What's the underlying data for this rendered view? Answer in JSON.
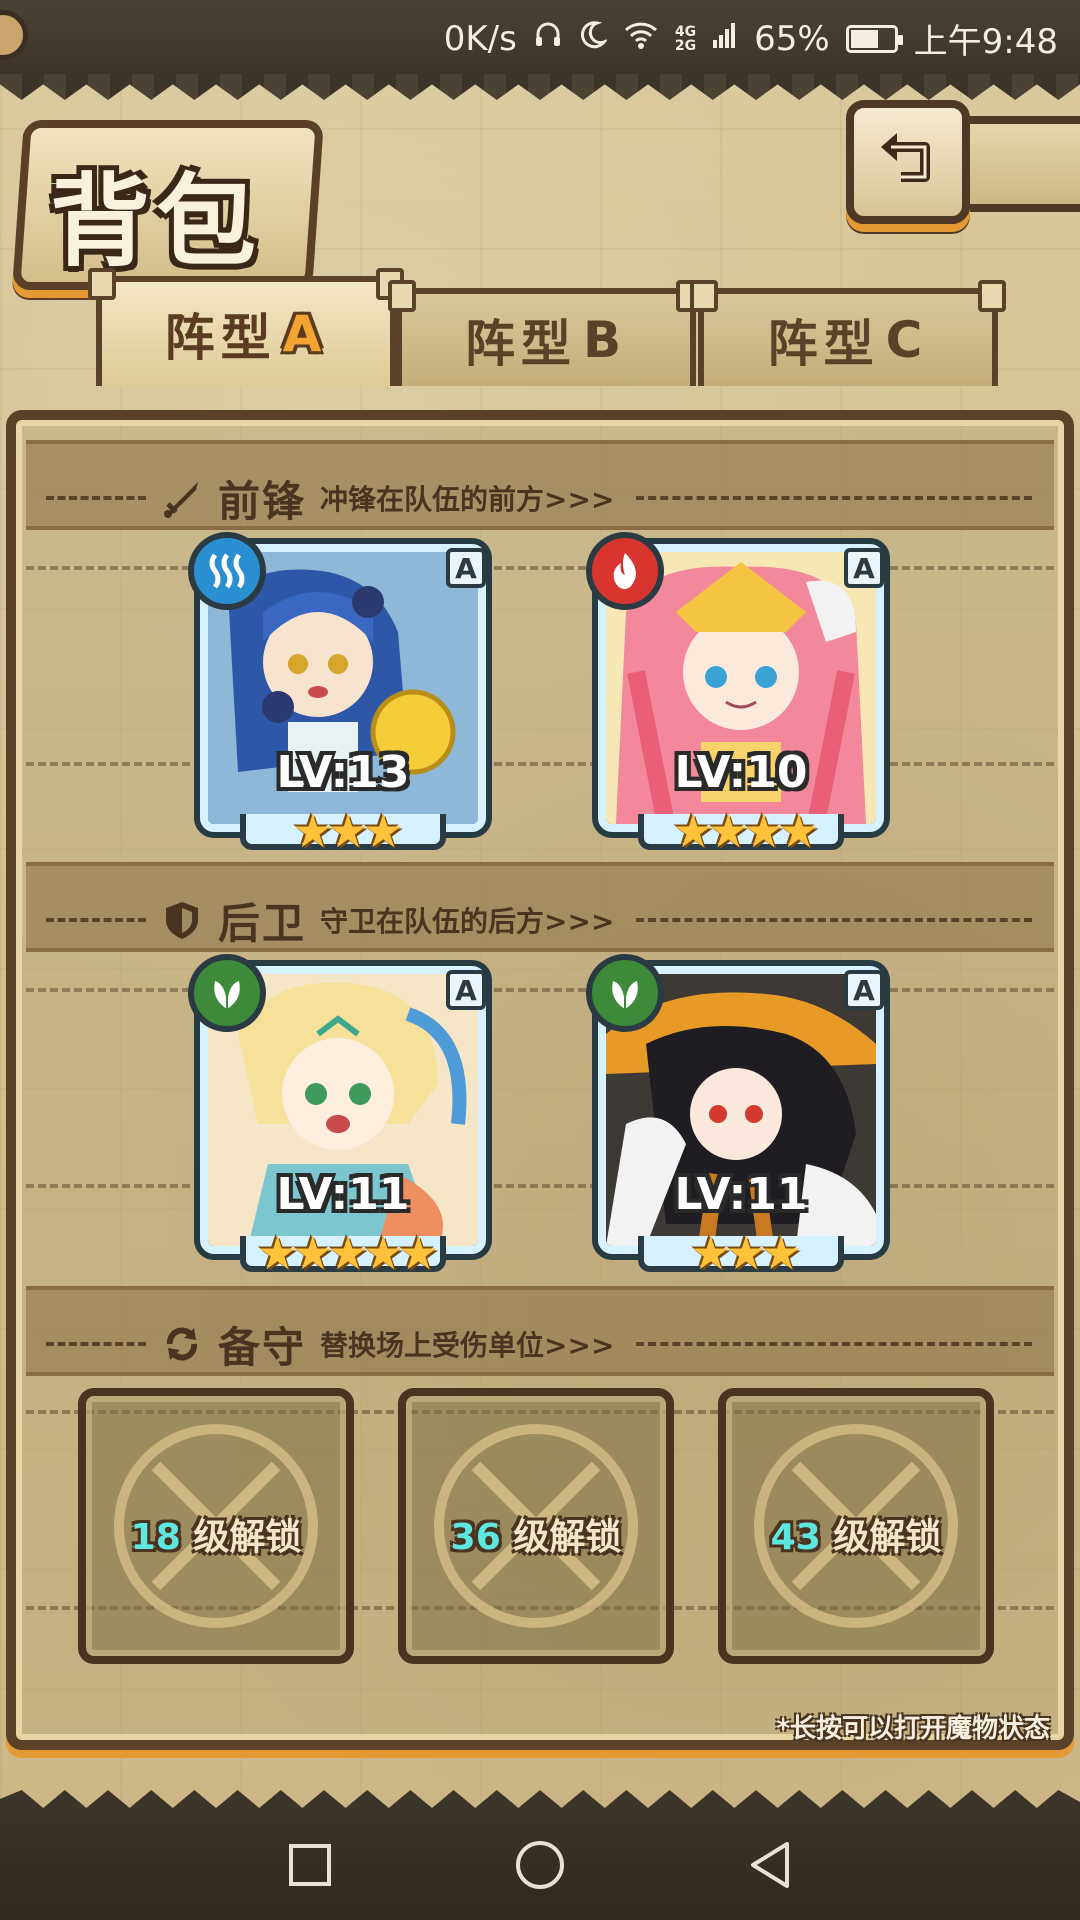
{
  "status_bar": {
    "speed": "0K/s",
    "network": [
      "4G",
      "2G"
    ],
    "battery": "65%",
    "battery_level": 0.65,
    "time": "上午9:48"
  },
  "title": "背包",
  "tabs": [
    {
      "label": "阵型",
      "letter": "A",
      "active": true
    },
    {
      "label": "阵型",
      "letter": "B",
      "active": false
    },
    {
      "label": "阵型",
      "letter": "C",
      "active": false
    }
  ],
  "sections": {
    "front": {
      "title": "前锋",
      "desc": "冲锋在队伍的前方>>>",
      "icon": "sword-icon"
    },
    "back": {
      "title": "后卫",
      "desc": "守卫在队伍的后方>>>",
      "icon": "shield-icon"
    },
    "reserve": {
      "title": "备守",
      "desc": "替换场上受伤单位>>>",
      "icon": "swap-icon"
    }
  },
  "front_cards": [
    {
      "level": "LV:13",
      "rank": "A",
      "element": "water-icon",
      "element_color": "#2a8fd0",
      "stars": 3,
      "star_text": "★★★"
    },
    {
      "level": "LV:10",
      "rank": "A",
      "element": "fire-icon",
      "element_color": "#d9352f",
      "stars": 4,
      "star_text": "★★★★"
    }
  ],
  "back_cards": [
    {
      "level": "LV:11",
      "rank": "A",
      "element": "leaf-icon",
      "element_color": "#3c8a3a",
      "stars": 5,
      "star_text": "★★★★★"
    },
    {
      "level": "LV:11",
      "rank": "A",
      "element": "leaf-icon",
      "element_color": "#3c8a3a",
      "stars": 3,
      "star_text": "★★★"
    }
  ],
  "reserve_slots": [
    {
      "level": "18",
      "suffix": "级解锁"
    },
    {
      "level": "36",
      "suffix": "级解锁"
    },
    {
      "level": "43",
      "suffix": "级解锁"
    }
  ],
  "hint": "*长按可以打开魔物状态",
  "colors": {
    "frame_dark": "#5a4128",
    "accent_orange": "#e39a34",
    "card_border": "#d6f1ff",
    "unlock_level": "#5ee6e0"
  }
}
